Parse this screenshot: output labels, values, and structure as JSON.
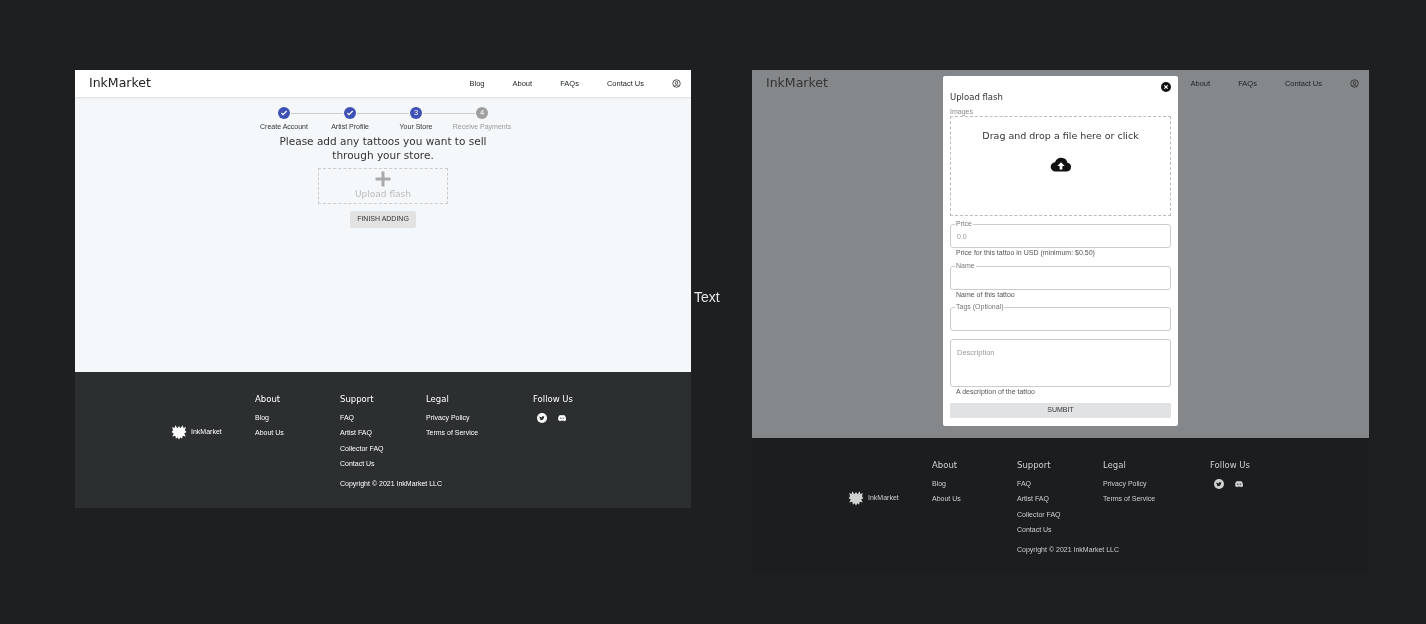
{
  "canvas_label": "Text",
  "left_screen": {
    "header": {
      "brand": "InkMarket",
      "nav": [
        "Blog",
        "About",
        "FAQs",
        "Contact Us"
      ]
    },
    "steps": [
      {
        "label": "Create Account",
        "completed": true,
        "active": true
      },
      {
        "label": "Artist Profile",
        "completed": true,
        "active": true
      },
      {
        "label": "Your Store",
        "completed": false,
        "active": true,
        "number": "3"
      },
      {
        "label": "Receive Payments",
        "completed": false,
        "active": false,
        "number": "4"
      }
    ],
    "heading": "Please add any tattoos you want to sell through your store.",
    "upload_tile": {
      "label": "Upload flash"
    },
    "finish_button": "FINISH ADDING",
    "footer": {
      "brand": "InkMarket",
      "columns": [
        {
          "title": "About",
          "links": [
            "Blog",
            "About Us"
          ]
        },
        {
          "title": "Support",
          "links": [
            "FAQ",
            "Artist FAQ",
            "Collector FAQ",
            "Contact Us"
          ]
        },
        {
          "title": "Legal",
          "links": [
            "Privacy Policy",
            "Terms of Service"
          ]
        }
      ],
      "follow_title": "Follow Us",
      "copyright": "Copyright © 2021 InkMarket LLC"
    }
  },
  "right_screen": {
    "header": {
      "brand": "InkMarket",
      "nav": [
        "About",
        "FAQs",
        "Contact Us"
      ]
    },
    "modal": {
      "title": "Upload flash",
      "dropzone_label": "Images",
      "dropzone_text": "Drag and drop a file here or click",
      "fields": [
        {
          "kind": "outlined",
          "label": "Price",
          "placeholder": "0.0",
          "helper": "Price for this tattoo in USD (minimum: $0.50)"
        },
        {
          "kind": "outlined",
          "label": "Name",
          "helper": "Name of this tattoo"
        },
        {
          "kind": "outlined",
          "label": "Tags (Optional)"
        },
        {
          "kind": "textarea",
          "placeholder": "Description",
          "helper": "A description of the tattoo"
        }
      ],
      "submit": "SUMBIT"
    },
    "footer": {
      "brand": "InkMarket",
      "columns": [
        {
          "title": "About",
          "links": [
            "Blog",
            "About Us"
          ]
        },
        {
          "title": "Support",
          "links": [
            "FAQ",
            "Artist FAQ",
            "Collector FAQ",
            "Contact Us"
          ]
        },
        {
          "title": "Legal",
          "links": [
            "Privacy Policy",
            "Terms of Service"
          ]
        }
      ],
      "follow_title": "Follow Us",
      "copyright": "Copyright © 2021 InkMarket LLC"
    }
  }
}
